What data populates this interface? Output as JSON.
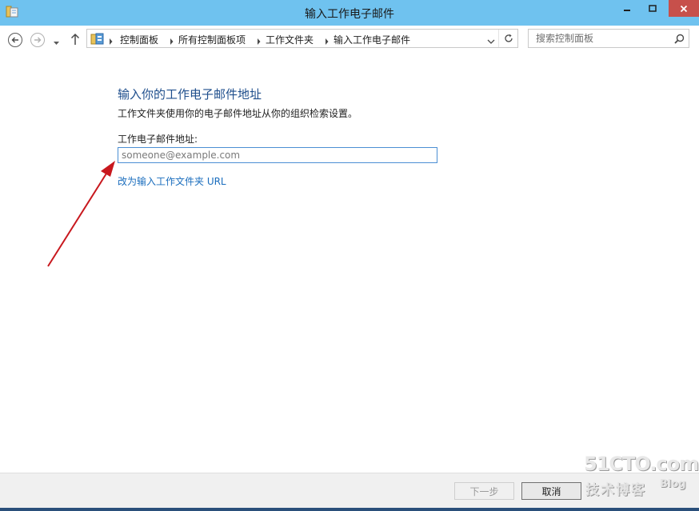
{
  "window": {
    "title": "输入工作电子邮件",
    "icon": "folder-icon",
    "controls": [
      "minimize-icon",
      "maximize-icon",
      "close-icon"
    ]
  },
  "nav": {
    "back_icon": "back-arrow-icon",
    "forward_icon": "forward-arrow-icon",
    "recent_icon": "chevron-down-icon",
    "up_icon": "up-arrow-icon"
  },
  "address": {
    "breadcrumbs": [
      "控制面板",
      "所有控制面板项",
      "工作文件夹",
      "输入工作电子邮件"
    ],
    "refresh_icon": "refresh-icon"
  },
  "search": {
    "placeholder": "搜索控制面板"
  },
  "main": {
    "heading": "输入你的工作电子邮件地址",
    "description": "工作文件夹使用你的电子邮件地址从你的组织检索设置。",
    "email_label": "工作电子邮件地址:",
    "email_placeholder": "someone@example.com",
    "email_value": "",
    "url_link": "改为输入工作文件夹 URL"
  },
  "footer": {
    "next_label": "下一步",
    "cancel_label": "取消"
  },
  "watermark": {
    "main": "51CTO.com",
    "sub": "技术博客",
    "blog": "Blog"
  },
  "colors": {
    "titlebar": "#6fc2ef",
    "close_button": "#c7504b",
    "heading": "#1e4e8c",
    "link": "#1a6dbd",
    "annotation_arrow": "#c8181e"
  }
}
